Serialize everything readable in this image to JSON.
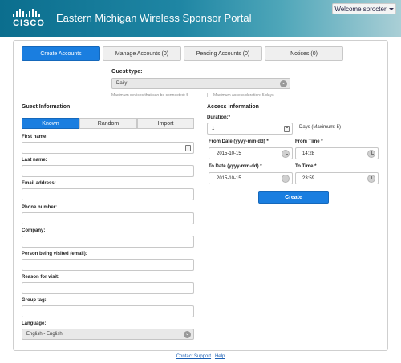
{
  "header": {
    "logo_text": "CISCO",
    "portal_title": "Eastern Michigan Wireless Sponsor Portal",
    "welcome_label": "Welcome sprocter"
  },
  "tabs": [
    {
      "label": "Create Accounts",
      "active": true
    },
    {
      "label": "Manage Accounts (0)",
      "active": false
    },
    {
      "label": "Pending Accounts (0)",
      "active": false
    },
    {
      "label": "Notices (0)",
      "active": false
    }
  ],
  "guest_type": {
    "label": "Guest type:",
    "selected": "Daily",
    "hint_devices": "Maximum devices that can be connected: 5",
    "hint_separator": "|",
    "hint_duration": "Maximum access duration: 5 days"
  },
  "guest_info": {
    "title": "Guest Information",
    "modes": [
      "Known",
      "Random",
      "Import"
    ],
    "fields": {
      "first_name": {
        "label": "First name:",
        "value": ""
      },
      "last_name": {
        "label": "Last name:",
        "value": ""
      },
      "email": {
        "label": "Email address:",
        "value": ""
      },
      "phone": {
        "label": "Phone number:",
        "value": ""
      },
      "company": {
        "label": "Company:",
        "value": ""
      },
      "person_visited": {
        "label": "Person being visited (email):",
        "value": ""
      },
      "reason": {
        "label": "Reason for visit:",
        "value": ""
      },
      "group_tag": {
        "label": "Group tag:",
        "value": ""
      }
    },
    "language": {
      "label": "Language:",
      "selected": "English - English"
    }
  },
  "access_info": {
    "title": "Access Information",
    "duration_label": "Duration:*",
    "duration_value": "1",
    "duration_hint": "Days (Maximum: 5)",
    "from_date_label": "From Date (yyyy-mm-dd) *",
    "from_date_value": "2015-10-15",
    "from_time_label": "From Time *",
    "from_time_value": "14:28",
    "to_date_label": "To Date (yyyy-mm-dd) *",
    "to_date_value": "2015-10-15",
    "to_time_label": "To Time *",
    "to_time_value": "23:59",
    "create_label": "Create"
  },
  "footer": {
    "contact_label": "Contact Support",
    "separator": "|",
    "help_label": "Help"
  },
  "colors": {
    "accent": "#1a7ee0",
    "header_start": "#0b6e8e",
    "header_end": "#aacfd6"
  }
}
